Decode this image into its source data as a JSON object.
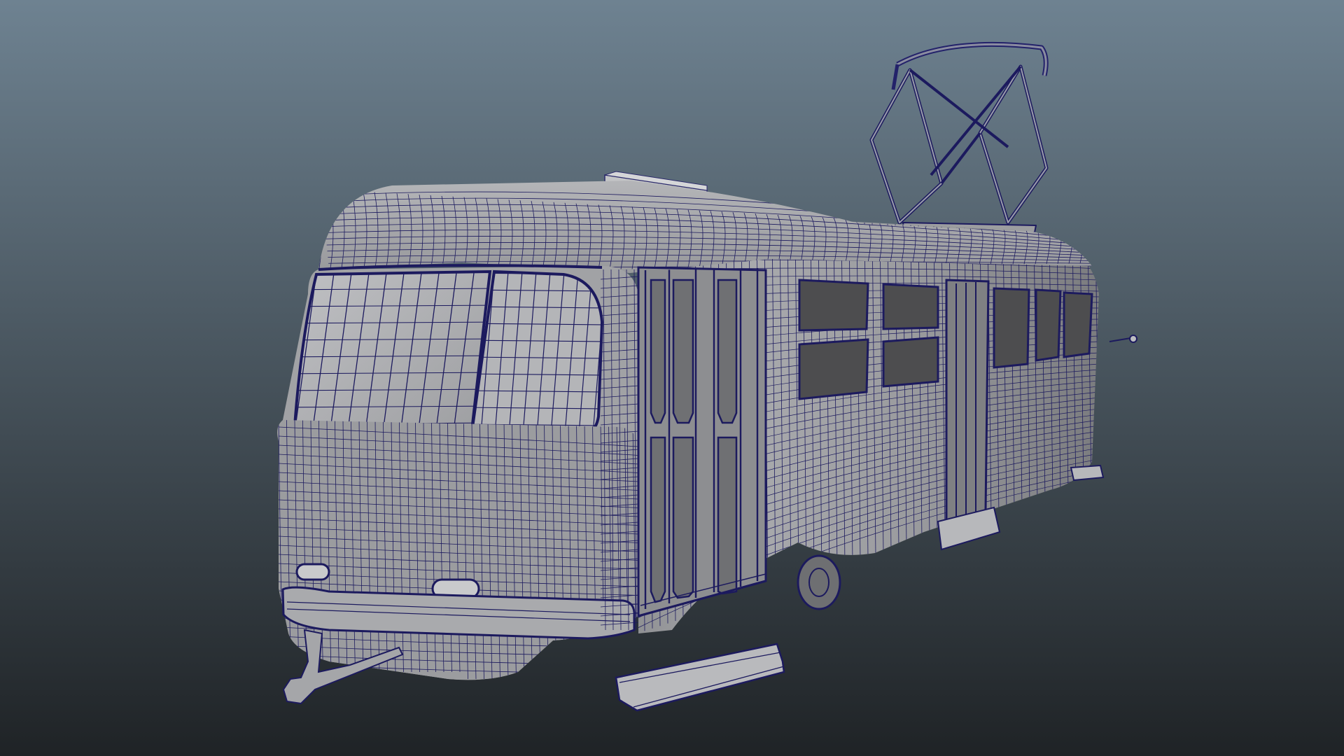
{
  "viewport": {
    "background_top": "#6e8291",
    "background_bottom": "#1f2326",
    "wire_color": "#1c1a5e",
    "shade_color": "#a8a9ab",
    "shade_light": "#c6c7c9",
    "shade_dark": "#7e7f82",
    "glass_color": "#4d4d4f",
    "model": "tram-wireframe"
  }
}
